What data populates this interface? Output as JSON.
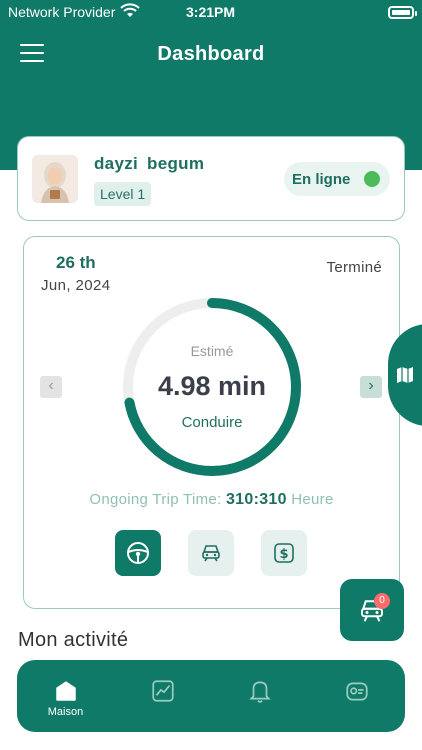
{
  "status_bar": {
    "carrier": "Network Provider",
    "time": "3:21PM"
  },
  "header": {
    "title": "Dashboard"
  },
  "profile": {
    "name": "dayzi  begum",
    "level": "Level 1",
    "online_label": "En ligne",
    "online": true
  },
  "trip": {
    "day": "26 th",
    "month_year": "Jun, 2024",
    "status": "Terminé",
    "estimate_label": "Estimé",
    "duration": "4.98 min",
    "mode": "Conduire",
    "progress": 0.72,
    "ongoing_label": "Ongoing Trip Time:",
    "ongoing_value": "310:310",
    "ongoing_unit": "Heure"
  },
  "fab": {
    "badge": "0"
  },
  "section": {
    "activity_title": "Mon activité"
  },
  "bottom_nav": {
    "home_label": "Maison"
  },
  "colors": {
    "primary": "#0f7a67",
    "online_dot": "#4cbb5a",
    "badge": "#ff6b6b"
  },
  "icons": [
    "menu-icon",
    "wifi-icon",
    "battery-icon",
    "steering-wheel-icon",
    "car-icon",
    "dollar-icon",
    "map-icon",
    "home-icon",
    "chart-icon",
    "bell-icon",
    "profile-icon"
  ]
}
